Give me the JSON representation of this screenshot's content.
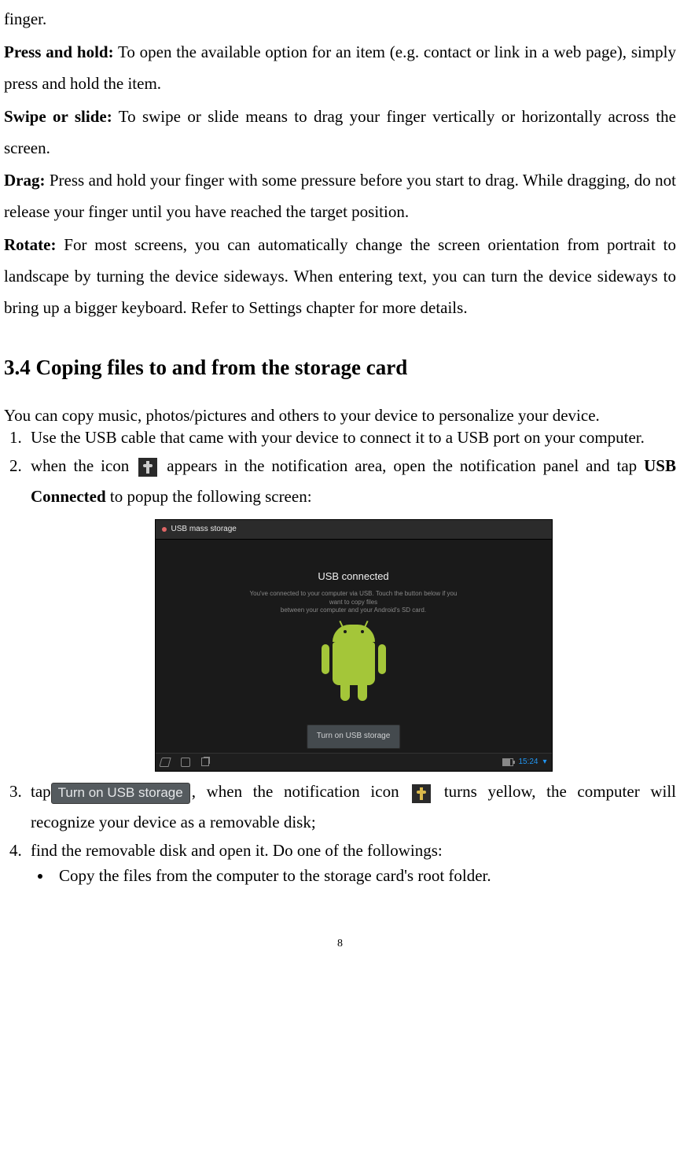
{
  "intro_frag": "finger.",
  "p_press_hold_label": "Press and hold:",
  "p_press_hold_text": " To open the available option for an item (e.g. contact or link in a web page), simply press and hold the item.",
  "p_swipe_label": "Swipe or slide:",
  "p_swipe_text": " To swipe or slide means to drag your finger vertically or horizontally across the screen.",
  "p_drag_label": "Drag:",
  "p_drag_text": " Press and hold your finger with some pressure before you start to drag. While dragging, do not release your finger until you have reached the target position.",
  "p_rotate_label": "Rotate:",
  "p_rotate_text": " For most screens, you can automatically change the screen orientation from portrait to landscape by turning the device sideways. When entering text, you can turn the device sideways to bring up a bigger keyboard. Refer to Settings chapter for more details.",
  "heading": "3.4 Coping files to and from the storage card",
  "p_intro2": "You can copy music, photos/pictures and others to your device to personalize your device.",
  "step1": "Use the USB cable that came with your device to connect it to a USB port on your computer.",
  "step2_a": "when the icon ",
  "step2_b": " appears in the notification area, open the notification panel and tap ",
  "step2_bold": "USB Connected",
  "step2_c": " to popup the following screen:",
  "step3_a": "tap",
  "step3_btn": "Turn on USB storage",
  "step3_b": ", when the notification icon ",
  "step3_c": " turns yellow, the computer will recognize your device as a removable disk;",
  "step4": "find the removable disk and open it. Do one of the followings:",
  "bullet1": "Copy the files from the computer to the storage card's root folder.",
  "screenshot": {
    "status_title": "USB mass storage",
    "card_title": "USB connected",
    "card_sub1": "You've connected to your computer via USB. Touch the button below if you want to copy files",
    "card_sub2": "between your computer and your Android's SD card.",
    "turn_on": "Turn on USB storage",
    "time": "15:24",
    "wifi_icon": "▾"
  },
  "page_no": "8"
}
